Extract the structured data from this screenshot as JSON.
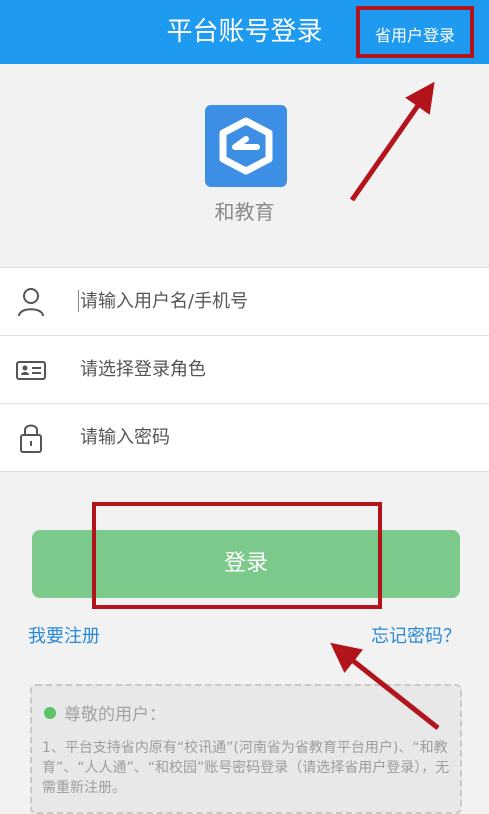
{
  "header": {
    "title": "平台账号登录",
    "province_login": "省用户登录"
  },
  "app": {
    "name": "和教育"
  },
  "form": {
    "username_placeholder": "请输入用户名/手机号",
    "role_placeholder": "请选择登录角色",
    "password_placeholder": "请输入密码"
  },
  "actions": {
    "login": "登录",
    "register": "我要注册",
    "forgot": "忘记密码？"
  },
  "notice": {
    "heading": "尊敬的用户：",
    "text": "1、平台支持省内原有“校讯通”(河南省为省教育平台用户)、“和教育”、“人人通”、“和校园”账号密码登录（请选择省用户登录），无需重新注册。"
  },
  "colors": {
    "header": "#1e9bf0",
    "login_button": "#7bc98b",
    "link": "#2a89d6",
    "annotation": "#b3141c"
  }
}
